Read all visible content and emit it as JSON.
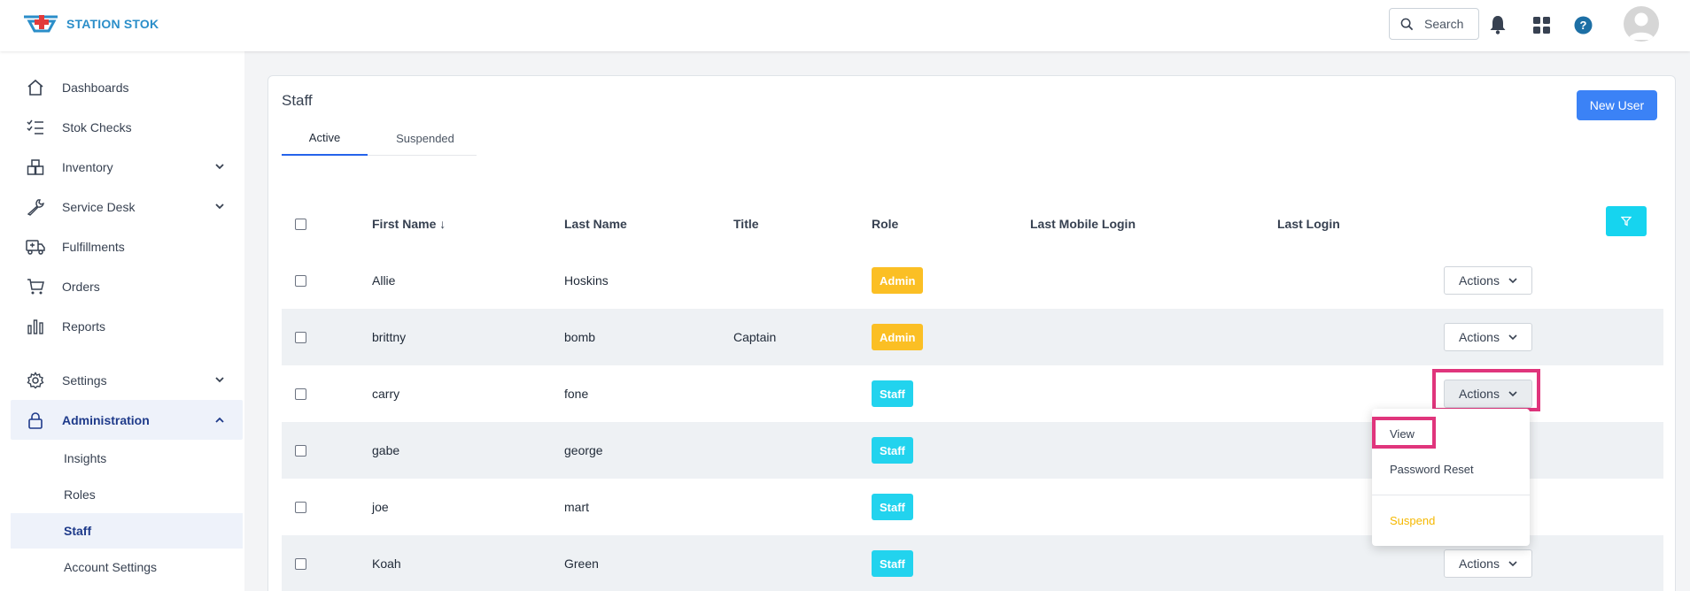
{
  "app": {
    "brand": "STATION STOK"
  },
  "topbar": {
    "search_label": "Search"
  },
  "sidebar": {
    "items": [
      {
        "label": "Dashboards",
        "icon": "home-icon"
      },
      {
        "label": "Stok Checks",
        "icon": "checklist-icon"
      },
      {
        "label": "Inventory",
        "icon": "boxes-icon"
      },
      {
        "label": "Service Desk",
        "icon": "wrench-icon"
      },
      {
        "label": "Fulfillments",
        "icon": "truck-icon"
      },
      {
        "label": "Orders",
        "icon": "cart-icon"
      },
      {
        "label": "Reports",
        "icon": "bar-chart-icon"
      },
      {
        "label": "Settings",
        "icon": "gear-icon"
      },
      {
        "label": "Administration",
        "icon": "lock-icon"
      }
    ],
    "admin_sub": [
      {
        "label": "Insights"
      },
      {
        "label": "Roles"
      },
      {
        "label": "Staff"
      },
      {
        "label": "Account Settings"
      }
    ]
  },
  "page": {
    "title": "Staff",
    "new_user_label": "New User",
    "tabs": [
      {
        "label": "Active"
      },
      {
        "label": "Suspended"
      }
    ]
  },
  "table": {
    "headers": {
      "first_name": "First Name ↓",
      "last_name": "Last Name",
      "title": "Title",
      "role": "Role",
      "last_mobile_login": "Last Mobile Login",
      "last_login": "Last Login"
    },
    "actions_label": "Actions",
    "rows": [
      {
        "first": "Allie",
        "last": "Hoskins",
        "title": "",
        "role": "Admin"
      },
      {
        "first": "brittny",
        "last": "bomb",
        "title": "Captain",
        "role": "Admin"
      },
      {
        "first": "carry",
        "last": "fone",
        "title": "",
        "role": "Staff"
      },
      {
        "first": "gabe",
        "last": "george",
        "title": "",
        "role": "Staff"
      },
      {
        "first": "joe",
        "last": "mart",
        "title": "",
        "role": "Staff"
      },
      {
        "first": "Koah",
        "last": "Green",
        "title": "",
        "role": "Staff"
      }
    ]
  },
  "dropdown": {
    "items": [
      {
        "label": "View"
      },
      {
        "label": "Password Reset"
      },
      {
        "label": "Suspend"
      }
    ]
  },
  "colors": {
    "primary": "#3b82f6",
    "admin_badge": "#fbbf24",
    "staff_badge": "#22d3ee",
    "filter_button": "#16d4ef",
    "highlight": "#e0357c",
    "suspend_text": "#f5b800",
    "active_nav_text": "#1e3a8a"
  }
}
